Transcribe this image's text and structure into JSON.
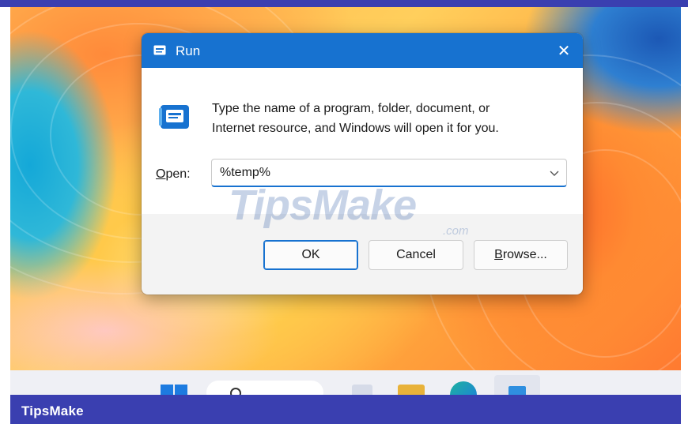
{
  "dialog": {
    "title": "Run",
    "close_glyph": "✕",
    "description_line1": "Type the name of a program, folder, document, or",
    "description_line2": "Internet resource, and Windows will open it for you.",
    "open_label_accel": "O",
    "open_label_rest": "pen:",
    "open_value": "%temp%",
    "buttons": {
      "ok": "OK",
      "cancel": "Cancel",
      "browse_accel": "B",
      "browse_rest": "rowse..."
    },
    "icons": [
      "run-app-icon",
      "close-icon",
      "chevron-down-icon"
    ]
  },
  "watermark": {
    "main": "TipsMake",
    "domain": ".com"
  },
  "footer": {
    "brand": "TipsMake"
  },
  "taskbar": {
    "icons": [
      "start-icon",
      "search-icon",
      "app-icon",
      "file-explorer-icon",
      "edge-icon",
      "run-icon"
    ]
  },
  "colors": {
    "titlebar": "#1772d0",
    "band": "#3a3fb0",
    "accent": "#1772d0"
  }
}
